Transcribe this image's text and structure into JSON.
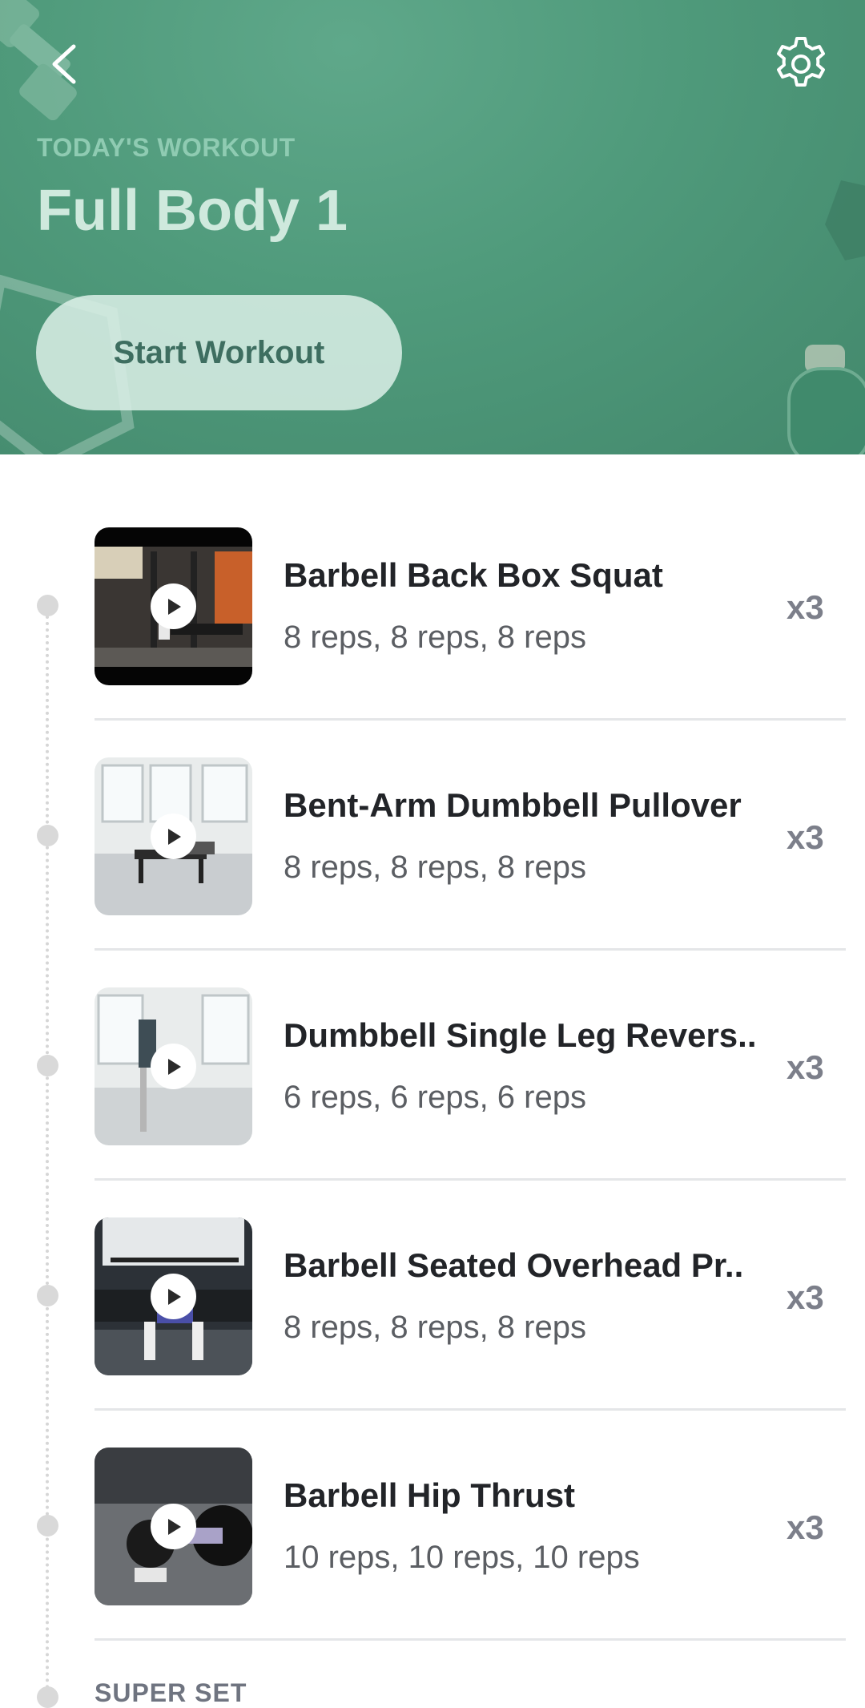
{
  "header": {
    "subtitle": "TODAY'S WORKOUT",
    "title": "Full Body 1",
    "start_button_label": "Start Workout",
    "back_icon": "chevron-left-icon",
    "settings_icon": "gear-icon"
  },
  "exercises": [
    {
      "name": "Barbell Back Box Squat",
      "reps": "8 reps, 8 reps, 8 reps",
      "sets": "x3"
    },
    {
      "name": "Bent-Arm Dumbbell Pullover",
      "reps": "8 reps, 8 reps, 8 reps",
      "sets": "x3"
    },
    {
      "name": "Dumbbell Single Leg Revers..",
      "reps": "6 reps, 6 reps, 6 reps",
      "sets": "x3"
    },
    {
      "name": "Barbell Seated Overhead Pr..",
      "reps": "8 reps, 8 reps, 8 reps",
      "sets": "x3"
    },
    {
      "name": "Barbell Hip Thrust",
      "reps": "10 reps, 10 reps, 10 reps",
      "sets": "x3"
    }
  ],
  "next_section_label": "SUPER SET",
  "colors": {
    "hero_green": "#4f9a7b",
    "start_button_bg": "#dcf0e8",
    "title_text": "#222428",
    "sets_text": "#7c7f8a"
  }
}
